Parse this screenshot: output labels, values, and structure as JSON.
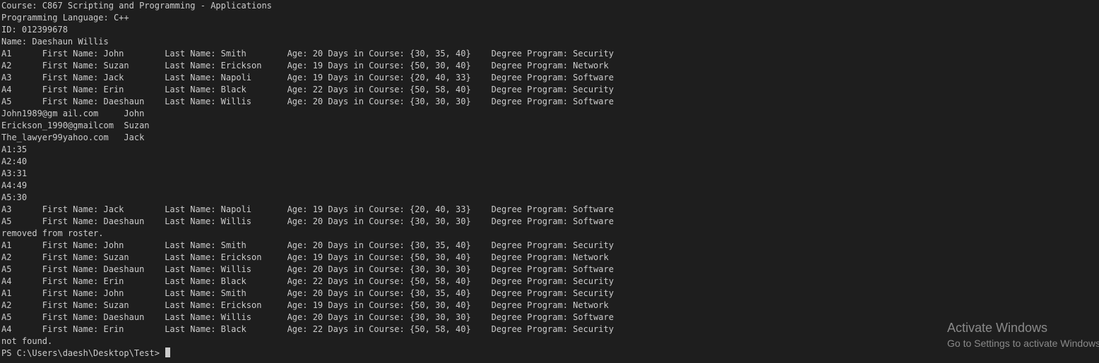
{
  "terminal": {
    "lines": [
      "Course: C867 Scripting and Programming - Applications",
      "Programming Language: C++",
      "ID: 012399678",
      "Name: Daeshaun Willis",
      "A1\tFirst Name: John\tLast Name: Smith\tAge: 20 Days in Course: {30, 35, 40}\tDegree Program: Security",
      "A2\tFirst Name: Suzan\tLast Name: Erickson\tAge: 19 Days in Course: {50, 30, 40}\tDegree Program: Network",
      "A3\tFirst Name: Jack\tLast Name: Napoli\tAge: 19 Days in Course: {20, 40, 33}\tDegree Program: Software",
      "A4\tFirst Name: Erin\tLast Name: Black\tAge: 22 Days in Course: {50, 58, 40}\tDegree Program: Security",
      "A5\tFirst Name: Daeshaun\tLast Name: Willis\tAge: 20 Days in Course: {30, 30, 30}\tDegree Program: Software",
      "John1989@gm ail.com\tJohn",
      "Erickson_1990@gmailcom\tSuzan",
      "The_lawyer99yahoo.com\tJack",
      "A1:35",
      "A2:40",
      "A3:31",
      "A4:49",
      "A5:30",
      "A3\tFirst Name: Jack\tLast Name: Napoli\tAge: 19 Days in Course: {20, 40, 33}\tDegree Program: Software",
      "A5\tFirst Name: Daeshaun\tLast Name: Willis\tAge: 20 Days in Course: {30, 30, 30}\tDegree Program: Software",
      "removed from roster.",
      "A1\tFirst Name: John\tLast Name: Smith\tAge: 20 Days in Course: {30, 35, 40}\tDegree Program: Security",
      "A2\tFirst Name: Suzan\tLast Name: Erickson\tAge: 19 Days in Course: {50, 30, 40}\tDegree Program: Network",
      "A5\tFirst Name: Daeshaun\tLast Name: Willis\tAge: 20 Days in Course: {30, 30, 30}\tDegree Program: Software",
      "A4\tFirst Name: Erin\tLast Name: Black\tAge: 22 Days in Course: {50, 58, 40}\tDegree Program: Security",
      "A1\tFirst Name: John\tLast Name: Smith\tAge: 20 Days in Course: {30, 35, 40}\tDegree Program: Security",
      "A2\tFirst Name: Suzan\tLast Name: Erickson\tAge: 19 Days in Course: {50, 30, 40}\tDegree Program: Network",
      "A5\tFirst Name: Daeshaun\tLast Name: Willis\tAge: 20 Days in Course: {30, 30, 30}\tDegree Program: Software",
      "A4\tFirst Name: Erin\tLast Name: Black\tAge: 22 Days in Course: {50, 58, 40}\tDegree Program: Security",
      "not found."
    ],
    "prompt": "PS C:\\Users\\daesh\\Desktop\\Test> "
  },
  "watermark": {
    "title": "Activate Windows",
    "subtitle": "Go to Settings to activate Windows."
  },
  "colors": {
    "background": "#1e1e1e",
    "text": "#cccccc",
    "watermark": "#8a8a8a"
  }
}
